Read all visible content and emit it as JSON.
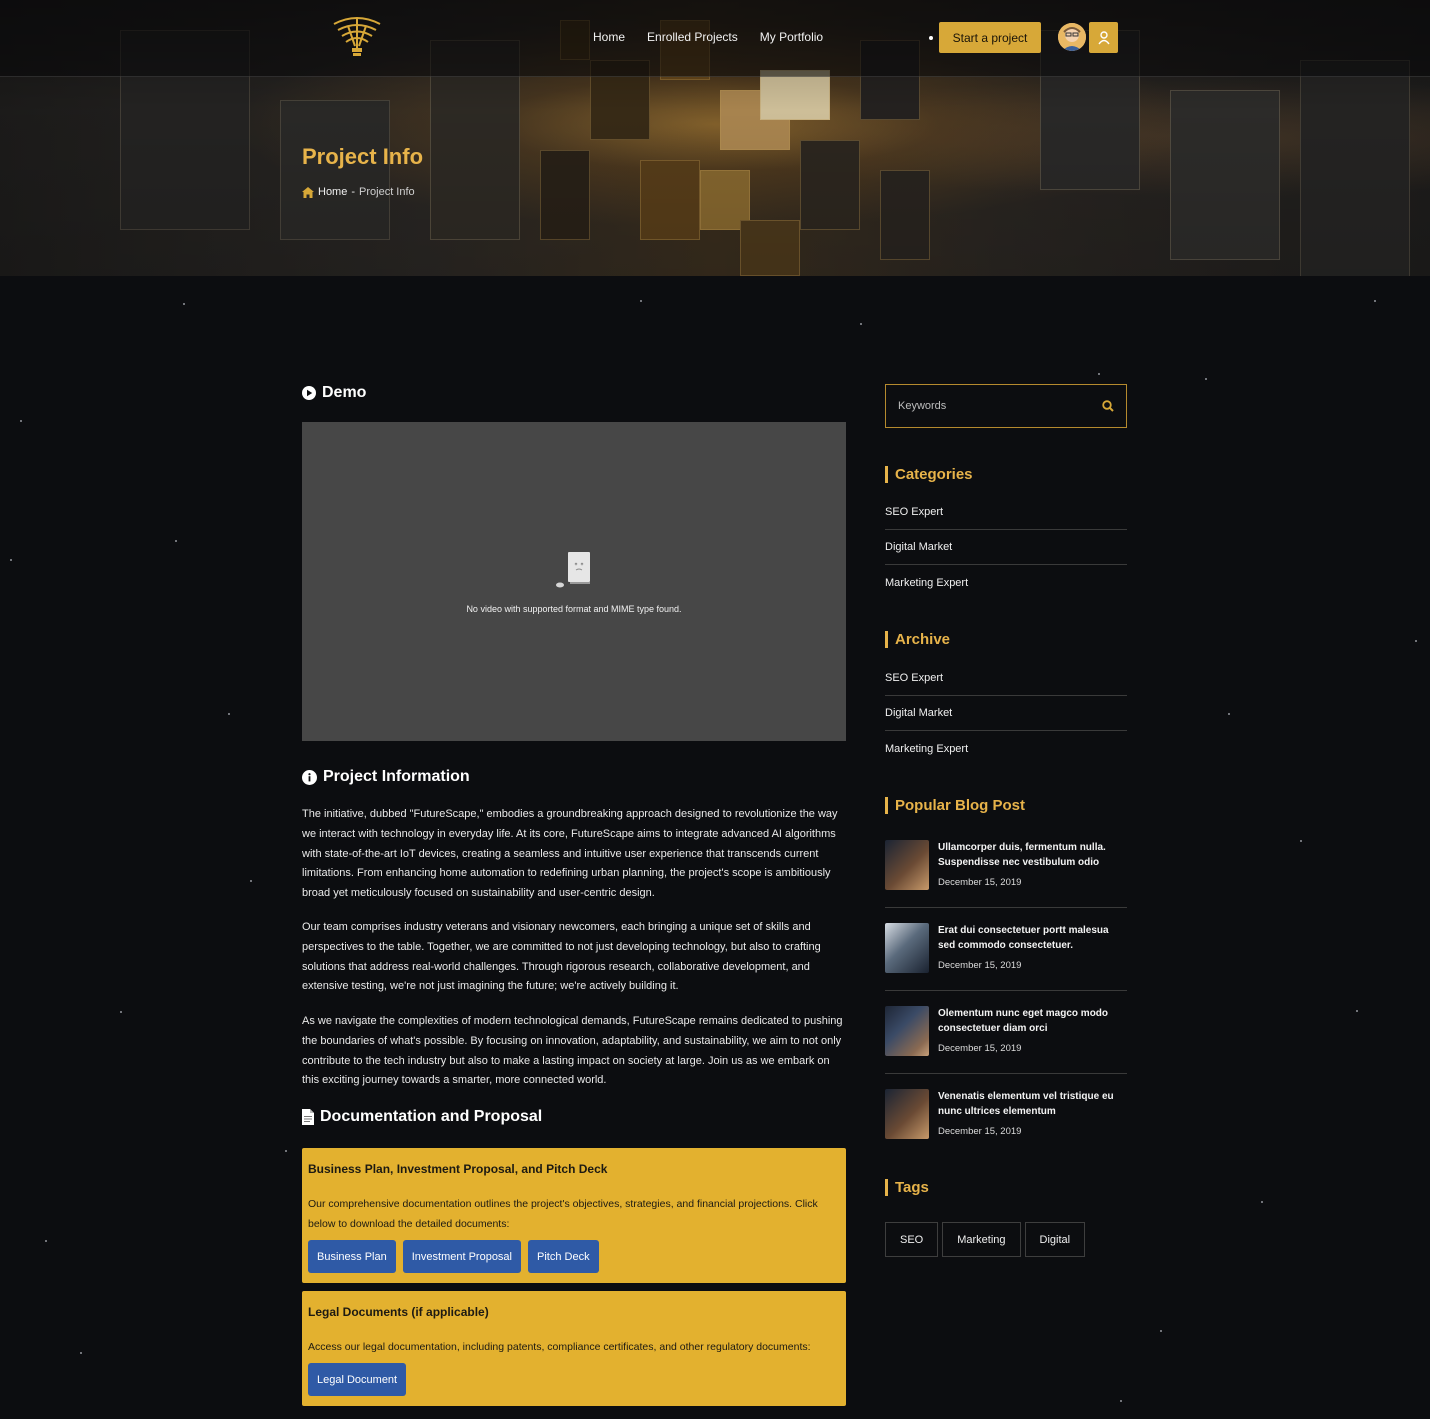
{
  "nav": {
    "links": [
      "Home",
      "Enrolled Projects",
      "My Portfolio"
    ],
    "start_button": "Start a project"
  },
  "hero": {
    "title": "Project Info",
    "breadcrumb_home": "Home",
    "breadcrumb_sep": "-",
    "breadcrumb_current": "Project Info"
  },
  "demo": {
    "heading": "Demo",
    "video_message": "No video with supported format and MIME type found."
  },
  "project_info": {
    "heading": "Project Information",
    "paragraphs": [
      "The initiative, dubbed \"FutureScape,\" embodies a groundbreaking approach designed to revolutionize the way we interact with technology in everyday life. At its core, FutureScape aims to integrate advanced AI algorithms with state-of-the-art IoT devices, creating a seamless and intuitive user experience that transcends current limitations. From enhancing home automation to redefining urban planning, the project's scope is ambitiously broad yet meticulously focused on sustainability and user-centric design.",
      "Our team comprises industry veterans and visionary newcomers, each bringing a unique set of skills and perspectives to the table. Together, we are committed to not just developing technology, but also to crafting solutions that address real-world challenges. Through rigorous research, collaborative development, and extensive testing, we're not just imagining the future; we're actively building it.",
      "As we navigate the complexities of modern technological demands, FutureScape remains dedicated to pushing the boundaries of what's possible. By focusing on innovation, adaptability, and sustainability, we aim to not only contribute to the tech industry but also to make a lasting impact on society at large. Join us as we embark on this exciting journey towards a smarter, more connected world."
    ]
  },
  "docs": {
    "heading": "Documentation and Proposal",
    "cards": [
      {
        "title": "Business Plan, Investment Proposal, and Pitch Deck",
        "text": "Our comprehensive documentation outlines the project's objectives, strategies, and financial projections. Click below to download the detailed documents:",
        "buttons": [
          "Business Plan",
          "Investment Proposal",
          "Pitch Deck"
        ]
      },
      {
        "title": "Legal Documents (if applicable)",
        "text": "Access our legal documentation, including patents, compliance certificates, and other regulatory documents:",
        "buttons": [
          "Legal Document"
        ]
      }
    ]
  },
  "sidebar": {
    "search_placeholder": "Keywords",
    "categories_title": "Categories",
    "categories": [
      "SEO Expert",
      "Digital Market",
      "Marketing Expert"
    ],
    "archive_title": "Archive",
    "archive": [
      "SEO Expert",
      "Digital Market",
      "Marketing Expert"
    ],
    "popular_title": "Popular Blog Post",
    "posts": [
      {
        "title": "Ullamcorper duis, fermentum nulla. Suspendisse nec vestibulum odio",
        "date": "December 15, 2019"
      },
      {
        "title": "Erat dui consectetuer portt malesua sed commodo consectetuer.",
        "date": "December 15, 2019"
      },
      {
        "title": "Olementum nunc eget magco modo consectetuer diam orci",
        "date": "December 15, 2019"
      },
      {
        "title": "Venenatis elementum vel tristique eu nunc ultrices elementum",
        "date": "December 15, 2019"
      }
    ],
    "tags_title": "Tags",
    "tags": [
      "SEO",
      "Marketing",
      "Digital"
    ]
  },
  "colors": {
    "accent": "#e7b34a",
    "button_gold": "#d7a838",
    "doc_card": "#e3b12f",
    "doc_button": "#2f5aa6",
    "page_bg": "#0c0d10"
  },
  "icons": [
    "logo-emblem",
    "home-icon",
    "play-icon",
    "info-icon",
    "document-icon",
    "search-icon",
    "user-icon",
    "broken-file-icon"
  ]
}
